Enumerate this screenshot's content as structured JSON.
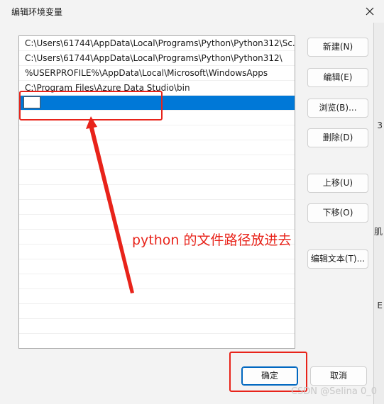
{
  "window": {
    "title": "编辑环境变量"
  },
  "path_list": {
    "items": [
      "C:\\Users\\61744\\AppData\\Local\\Programs\\Python\\Python312\\Sc...",
      "C:\\Users\\61744\\AppData\\Local\\Programs\\Python\\Python312\\",
      "%USERPROFILE%\\AppData\\Local\\Microsoft\\WindowsApps",
      "C:\\Program Files\\Azure Data Studio\\bin"
    ],
    "editing_value": ""
  },
  "buttons": {
    "new": "新建(N)",
    "edit": "编辑(E)",
    "browse": "浏览(B)...",
    "delete": "删除(D)",
    "move_up": "上移(U)",
    "move_down": "下移(O)",
    "edit_text": "编辑文本(T)...",
    "ok": "确定",
    "cancel": "取消"
  },
  "annotation": {
    "text": "python 的文件路径放进去",
    "color": "#e8231a"
  },
  "background_window": {
    "fragments": [
      "3",
      "肌",
      "E"
    ]
  },
  "watermark": "CSDN @Selina 0_0",
  "colors": {
    "selection": "#0078d7",
    "accent_border": "#0067c0"
  }
}
